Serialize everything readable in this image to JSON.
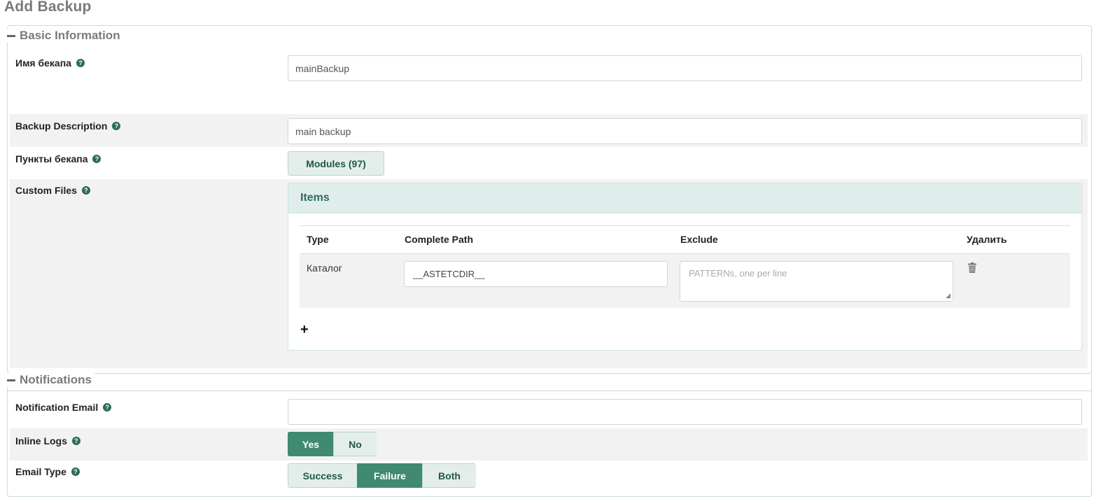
{
  "page_title": "Add Backup",
  "basic": {
    "legend": "Basic Information",
    "backup_name": {
      "label": "Имя бекапа",
      "value": "mainBackup"
    },
    "backup_description": {
      "label": "Backup Description",
      "value": "main backup"
    },
    "backup_items": {
      "label": "Пункты бекапа",
      "button": "Modules (97)"
    },
    "custom_files": {
      "label": "Custom Files",
      "panel_title": "Items",
      "columns": [
        "Type",
        "Complete Path",
        "Exclude",
        "Удалить"
      ],
      "rows": [
        {
          "type": "Каталог",
          "path": "__ASTETCDIR__",
          "exclude_placeholder": "PATTERNs, one per line",
          "delete_icon": "trash-icon"
        }
      ],
      "add_icon": "plus-icon"
    }
  },
  "notifications": {
    "legend": "Notifications",
    "email": {
      "label": "Notification Email",
      "value": ""
    },
    "inline_logs": {
      "label": "Inline Logs",
      "options": [
        "Yes",
        "No"
      ],
      "selected": "Yes"
    },
    "email_type": {
      "label": "Email Type",
      "options": [
        "Success",
        "Failure",
        "Both"
      ],
      "selected": "Failure"
    }
  },
  "colors": {
    "accent": "#3f8a70",
    "button_bg": "#e3eeea",
    "panel_header": "#dfeeeb",
    "legend_text": "#7a7a7a"
  }
}
